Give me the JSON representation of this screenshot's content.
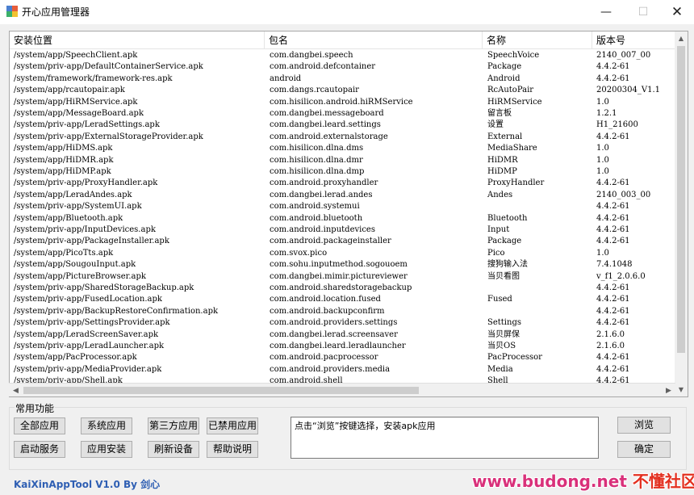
{
  "window": {
    "title": "开心应用管理器",
    "min_glyph": "—",
    "max_glyph": "☐",
    "close_glyph": "✕"
  },
  "table": {
    "columns": [
      "安装位置",
      "包名",
      "名称",
      "版本号"
    ],
    "rows": [
      [
        "/system/app/SpeechClient.apk",
        "com.dangbei.speech",
        "SpeechVoice",
        "2140_007_00"
      ],
      [
        "/system/priv-app/DefaultContainerService.apk",
        "com.android.defcontainer",
        "Package",
        "4.4.2-61"
      ],
      [
        "/system/framework/framework-res.apk",
        "android",
        "Android",
        "4.4.2-61"
      ],
      [
        "/system/app/rcautopair.apk",
        "com.dangs.rcautopair",
        "RcAutoPair",
        "20200304_V1.1"
      ],
      [
        "/system/app/HiRMService.apk",
        "com.hisilicon.android.hiRMService",
        "HiRMService",
        "1.0"
      ],
      [
        "/system/app/MessageBoard.apk",
        "com.dangbei.messageboard",
        "留言板",
        "1.2.1"
      ],
      [
        "/system/priv-app/LeradSettings.apk",
        "com.dangbei.leard.settings",
        "设置",
        "H1_21600"
      ],
      [
        "/system/priv-app/ExternalStorageProvider.apk",
        "com.android.externalstorage",
        "External",
        "4.4.2-61"
      ],
      [
        "/system/app/HiDMS.apk",
        "com.hisilicon.dlna.dms",
        "MediaShare",
        "1.0"
      ],
      [
        "/system/app/HiDMR.apk",
        "com.hisilicon.dlna.dmr",
        "HiDMR",
        "1.0"
      ],
      [
        "/system/app/HiDMP.apk",
        "com.hisilicon.dlna.dmp",
        "HiDMP",
        "1.0"
      ],
      [
        "/system/priv-app/ProxyHandler.apk",
        "com.android.proxyhandler",
        "ProxyHandler",
        "4.4.2-61"
      ],
      [
        "/system/app/LeradAndes.apk",
        "com.dangbei.lerad.andes",
        "Andes",
        "2140_003_00"
      ],
      [
        "/system/priv-app/SystemUI.apk",
        "com.android.systemui",
        "",
        "4.4.2-61"
      ],
      [
        "/system/app/Bluetooth.apk",
        "com.android.bluetooth",
        "Bluetooth",
        "4.4.2-61"
      ],
      [
        "/system/priv-app/InputDevices.apk",
        "com.android.inputdevices",
        "Input",
        "4.4.2-61"
      ],
      [
        "/system/priv-app/PackageInstaller.apk",
        "com.android.packageinstaller",
        "Package",
        "4.4.2-61"
      ],
      [
        "/system/app/PicoTts.apk",
        "com.svox.pico",
        "Pico",
        "1.0"
      ],
      [
        "/system/app/SougouInput.apk",
        "com.sohu.inputmethod.sogouoem",
        "搜狗输入法",
        "7.4.1048"
      ],
      [
        "/system/app/PictureBrowser.apk",
        "com.dangbei.mimir.pictureviewer",
        "当贝看图",
        "v_f1_2.0.6.0"
      ],
      [
        "/system/priv-app/SharedStorageBackup.apk",
        "com.android.sharedstoragebackup",
        "",
        "4.4.2-61"
      ],
      [
        "/system/priv-app/FusedLocation.apk",
        "com.android.location.fused",
        "Fused",
        "4.4.2-61"
      ],
      [
        "/system/priv-app/BackupRestoreConfirmation.apk",
        "com.android.backupconfirm",
        "",
        "4.4.2-61"
      ],
      [
        "/system/priv-app/SettingsProvider.apk",
        "com.android.providers.settings",
        "Settings",
        "4.4.2-61"
      ],
      [
        "/system/app/LeradScreenSaver.apk",
        "com.dangbei.lerad.screensaver",
        "当贝屏保",
        "2.1.6.0"
      ],
      [
        "/system/priv-app/LeradLauncher.apk",
        "com.dangbei.leard.leradlauncher",
        "当贝OS",
        "2.1.6.0"
      ],
      [
        "/system/app/PacProcessor.apk",
        "com.android.pacprocessor",
        "PacProcessor",
        "4.4.2-61"
      ],
      [
        "/system/priv-app/MediaProvider.apk",
        "com.android.providers.media",
        "Media",
        "4.4.2-61"
      ],
      [
        "/system/priv-app/Shell.apk",
        "com.android.shell",
        "Shell",
        "4.4.2-61"
      ]
    ]
  },
  "functions": {
    "group_title": "常用功能",
    "all_apps": "全部应用",
    "system_apps": "系统应用",
    "third_party_apps": "第三方应用",
    "disabled_apps": "已禁用应用",
    "start_service": "启动服务",
    "install_app": "应用安装",
    "refresh_device": "刷新设备",
    "help": "帮助说明",
    "browse": "浏览",
    "confirm": "确定"
  },
  "status": {
    "message": "点击“浏览”按键选择，安装apk应用"
  },
  "footer": {
    "credit": "KaiXinAppTool V1.0 By 剑心"
  },
  "watermark": {
    "site": "www.budong.net",
    "brand": "不懂社区"
  },
  "colors": {
    "footer_text": "#2f5fb3",
    "watermark_pink": "#d9307a",
    "watermark_red": "#e33020"
  }
}
